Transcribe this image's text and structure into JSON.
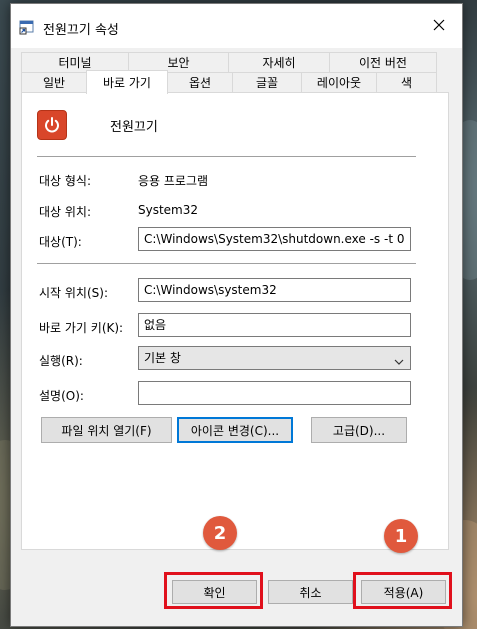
{
  "window": {
    "title": "전원끄기 속성"
  },
  "tabs_back": [
    "터미널",
    "보안",
    "자세히",
    "이전 버전"
  ],
  "tabs_front": [
    "일반",
    "바로 가기",
    "옵션",
    "글꼴",
    "레이아웃",
    "색"
  ],
  "active_tab": "바로 가기",
  "shortcut": {
    "name": "전원끄기",
    "target_type_label": "대상 형식:",
    "target_type_value": "응용 프로그램",
    "target_location_label": "대상 위치:",
    "target_location_value": "System32",
    "target_label": "대상(T):",
    "target_value": "C:\\Windows\\System32\\shutdown.exe -s -t 0",
    "start_in_label": "시작 위치(S):",
    "start_in_value": "C:\\Windows\\system32",
    "shortcut_key_label": "바로 가기 키(K):",
    "shortcut_key_value": "없음",
    "run_label": "실행(R):",
    "run_value": "기본 창",
    "comment_label": "설명(O):",
    "comment_value": ""
  },
  "buttons": {
    "open_location": "파일 위치 열기(F)",
    "change_icon": "아이콘 변경(C)...",
    "advanced": "고급(D)...",
    "ok": "확인",
    "cancel": "취소",
    "apply": "적용(A)"
  },
  "badges": {
    "first": "1",
    "second": "2"
  },
  "colors": {
    "highlight": "#e0101c",
    "badge": "#e0593d",
    "power_icon": "#d9462a"
  }
}
